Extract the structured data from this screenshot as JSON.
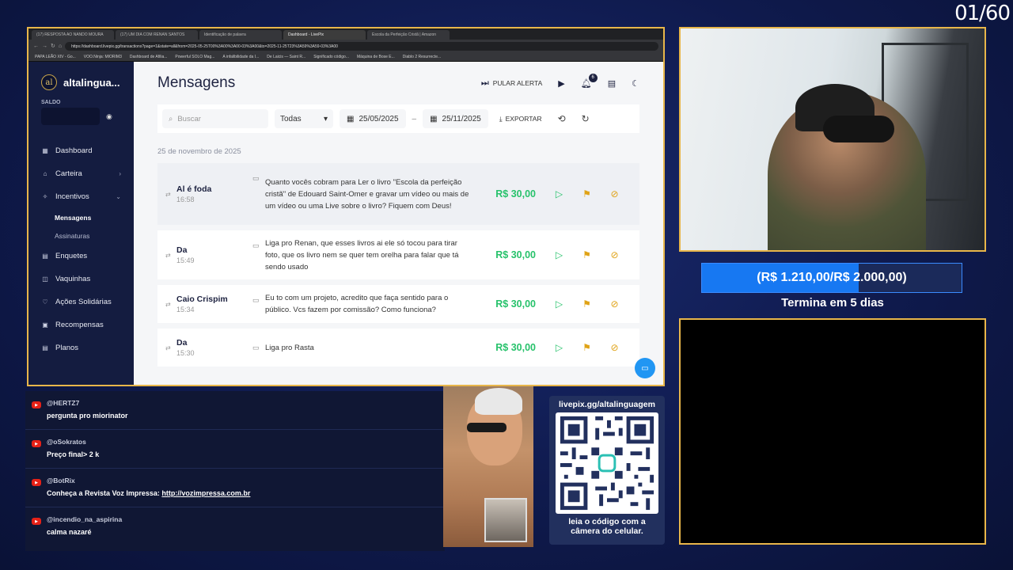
{
  "counter": "01/60",
  "browser": {
    "tabs": [
      "(17) RESPOSTA AO NANDO MOURA",
      "(17) UM DIA COM RENAN SANTOS",
      "Identificação de palavra",
      "Dashboard - LivePix",
      "Escola da Perfeição Cristã | Amazon"
    ],
    "url": "https://dashboard.livepix.gg/transactions?page=1&state=all&from=2025-05-25T00%3A00%3A00-03%3A00&to=2025-11-25T23%3A59%3A59-03%3A00",
    "bookmarks": [
      "PAPA LEÃO XIV - Go...",
      "VOO.Ninja: MIORIM3",
      "Dashboard de Afilia...",
      "Powerful SOLO Mag...",
      "A infalibilidade da I...",
      "De Laicis — Saint R...",
      "Significado código...",
      "Máquina de Bose E...",
      "Diablo 2 Resurrecte..."
    ]
  },
  "sidebar": {
    "brand": "altalingua...",
    "logo": "al",
    "saldo_label": "SALDO",
    "items": [
      {
        "label": "Dashboard",
        "icon": "▦"
      },
      {
        "label": "Carteira",
        "icon": "⌂",
        "chev": "›"
      },
      {
        "label": "Incentivos",
        "icon": "✧",
        "chev": "⌄"
      },
      {
        "label": "Enquetes",
        "icon": "▤"
      },
      {
        "label": "Vaquinhas",
        "icon": "◫"
      },
      {
        "label": "Ações Solidárias",
        "icon": "♡"
      },
      {
        "label": "Recompensas",
        "icon": "▣"
      },
      {
        "label": "Planos",
        "icon": "▤"
      }
    ],
    "subitems": [
      "Mensagens",
      "Assinaturas"
    ]
  },
  "header": {
    "title": "Mensagens",
    "pular": "PULAR ALERTA",
    "notif_count": "6"
  },
  "filters": {
    "search_placeholder": "Buscar",
    "type": "Todas",
    "date_from": "25/05/2025",
    "date_sep": "–",
    "date_to": "25/11/2025",
    "export": "EXPORTAR"
  },
  "date_header": "25 de novembro de 2025",
  "messages": [
    {
      "name": "Al é foda",
      "time": "16:58",
      "text": "Quanto vocês cobram para Ler o livro \"Escola da perfeição cristã\" de Edouard Saint-Omer e gravar um vídeo ou mais de um vídeo ou uma Live sobre o livro? Fiquem com Deus!",
      "value": "R$ 30,00"
    },
    {
      "name": "Da",
      "time": "15:49",
      "text": "Liga pro Renan, que esses livros ai ele só tocou para tirar foto, que os livro nem se quer tem orelha para falar que tá sendo usado",
      "value": "R$ 30,00"
    },
    {
      "name": "Caio Crispim",
      "time": "15:34",
      "text": "Eu to com um projeto, acredito que faça sentido para o público. Vcs fazem por comissão? Como funciona?",
      "value": "R$ 30,00"
    },
    {
      "name": "Da",
      "time": "15:30",
      "text": "Liga pro Rasta",
      "value": "R$ 30,00"
    }
  ],
  "goal": {
    "label": "(R$ 1.210,00/R$ 2.000,00)",
    "fraction": 0.605,
    "ends": "Termina em 5 dias"
  },
  "chat": [
    {
      "user": "@HERTZ7",
      "text": "pergunta pro miorinator"
    },
    {
      "user": "@oSokratos",
      "text": "Preço final> 2 k"
    },
    {
      "user": "@BotRix",
      "text": "Conheça a Revista Voz Impressa: ",
      "link": "http://vozimpressa.com.br"
    },
    {
      "user": "@incendio_na_aspirina",
      "text": "calma nazaré"
    }
  ],
  "qr": {
    "url": "livepix.gg/altalinguagem",
    "caption": "leia o código com a câmera do celular."
  }
}
